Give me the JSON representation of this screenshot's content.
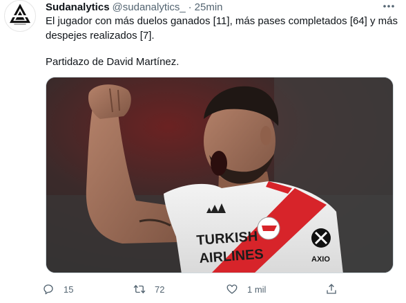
{
  "tweet": {
    "author": {
      "name": "Sudanalytics",
      "handle": "@sudanalytics_",
      "separator": "·",
      "time": "25min"
    },
    "text_line1": "El jugador con más duelos ganados [11], más pases completados [64] y más",
    "text_line2": "despejes realizados [7].",
    "text_line3": "Partidazo de David Martínez.",
    "media": {
      "shirt_sponsor_line1": "TURKISH",
      "shirt_sponsor_line2": "AIRLINES",
      "sleeve_sponsor": "AXIO"
    },
    "actions": {
      "reply_count": "15",
      "retweet_count": "72",
      "like_count": "1 mil"
    },
    "icons": {
      "more": "more-icon",
      "reply": "reply-icon",
      "retweet": "retweet-icon",
      "like": "like-icon",
      "share": "share-icon"
    },
    "colors": {
      "text": "#0f1419",
      "secondary": "#536471",
      "border": "#cfd9de"
    }
  }
}
